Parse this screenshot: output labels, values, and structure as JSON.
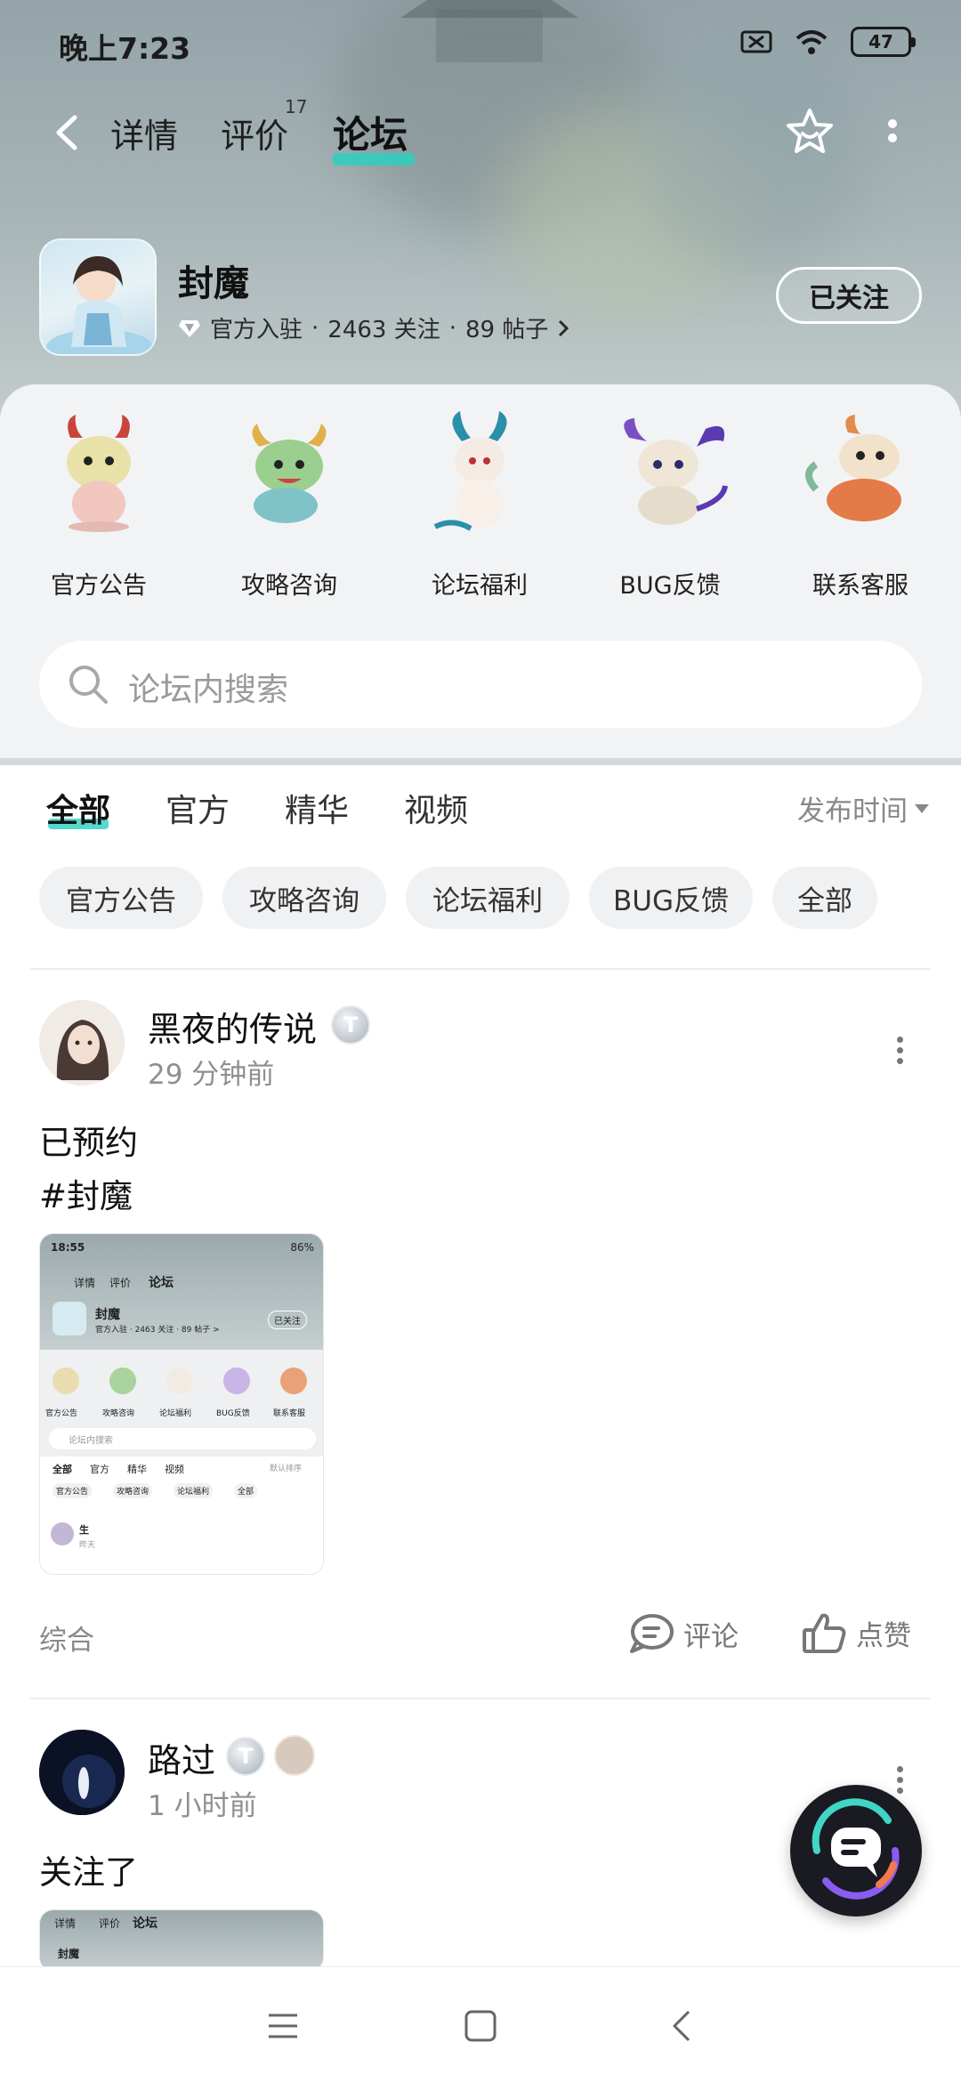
{
  "status_bar": {
    "time": "晚上7:23",
    "battery": "47"
  },
  "nav": {
    "tabs": [
      {
        "label": "详情"
      },
      {
        "label": "评价",
        "badge": "17"
      },
      {
        "label": "论坛",
        "active": true
      }
    ]
  },
  "game": {
    "name": "封魔",
    "official_label": "官方入驻",
    "followers": "2463 关注",
    "posts": "89 帖子",
    "follow_button": "已关注"
  },
  "categories": [
    {
      "label": "官方公告"
    },
    {
      "label": "攻略咨询"
    },
    {
      "label": "论坛福利"
    },
    {
      "label": "BUG反馈"
    },
    {
      "label": "联系客服"
    }
  ],
  "search": {
    "placeholder": "论坛内搜索"
  },
  "filter_tabs": [
    {
      "label": "全部",
      "active": true
    },
    {
      "label": "官方"
    },
    {
      "label": "精华"
    },
    {
      "label": "视频"
    }
  ],
  "sort_label": "发布时间",
  "chips": [
    "官方公告",
    "攻略咨询",
    "论坛福利",
    "BUG反馈",
    "全部"
  ],
  "posts": [
    {
      "user": "黑夜的传说",
      "badge": "T",
      "time": "29 分钟前",
      "lines": [
        "已预约",
        "#封魔"
      ],
      "thumb": {
        "time": "18:55",
        "battery": "86%",
        "tabs": [
          "详情",
          "评价",
          "论坛"
        ],
        "game": "封魔",
        "meta": "官方入驻 · 2463 关注 · 89 帖子 >",
        "follow": "已关注",
        "cats": [
          "官方公告",
          "攻略咨询",
          "论坛福利",
          "BUG反馈",
          "联系客服"
        ],
        "search": "论坛内搜索",
        "ftabs": [
          "全部",
          "官方",
          "精华",
          "视频"
        ],
        "sort": "默认排序",
        "chips": [
          "官方公告",
          "攻略咨询",
          "论坛福利",
          "全部"
        ],
        "post_user": "生",
        "post_time": "昨天"
      },
      "tag": "综合",
      "comment_label": "评论",
      "like_label": "点赞"
    },
    {
      "user": "路过",
      "badge": "T",
      "time": "1 小时前",
      "lines": [
        "关注了"
      ],
      "thumb": {
        "tabs": [
          "详情",
          "评价",
          "论坛"
        ],
        "game": "封魔"
      }
    }
  ],
  "colors": {
    "accent": "#2ad0c0",
    "panel": "#f2f3f5",
    "chip": "#f0f1f3"
  }
}
